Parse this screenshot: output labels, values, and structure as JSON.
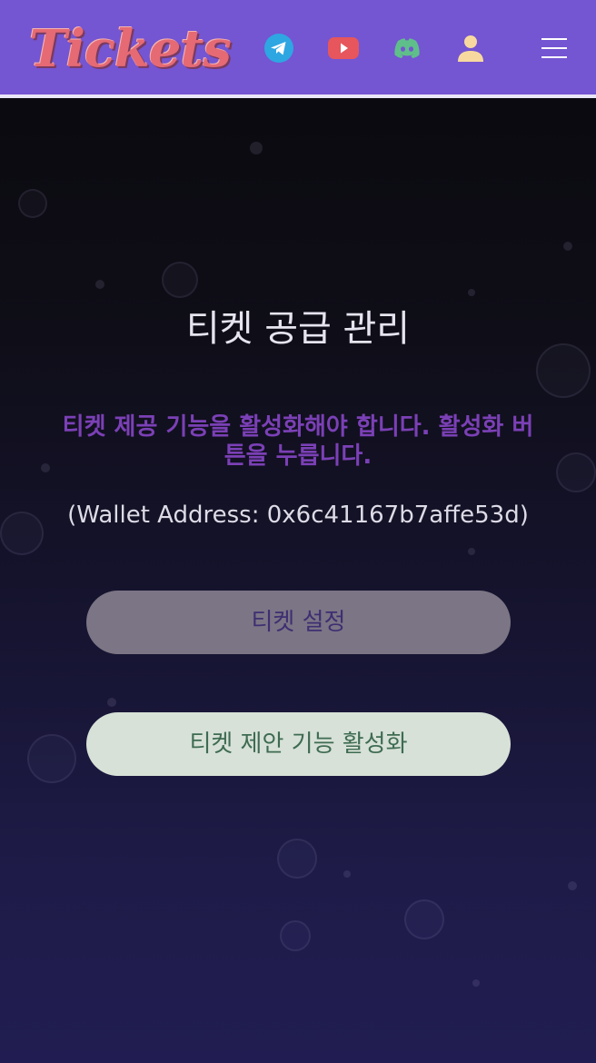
{
  "header": {
    "logo_text": "Tickets",
    "icons": [
      "telegram-icon",
      "youtube-icon",
      "discord-icon",
      "user-icon",
      "menu-icon"
    ],
    "colors": {
      "background": "#7455d2",
      "logo": "#e56a74",
      "telegram": "#2ea6e2",
      "youtube": "#e6565c",
      "discord": "#5fbf8a",
      "user": "#f7d9a0"
    }
  },
  "main": {
    "title": "티켓 공급 관리",
    "warning": "티켓 제공 기능을 활성화해야 합니다. 활성화 버튼을 누릅니다.",
    "wallet_label": "Wallet Address:",
    "wallet_address": "0x6c41167b7affe53d",
    "settings_button": "티켓 설정",
    "activate_button": "티켓 제안 기능 활성화",
    "colors": {
      "warning": "#7b40b6",
      "settings_button_bg": "#7c7585",
      "activate_button_bg": "#d7e1d7"
    }
  }
}
